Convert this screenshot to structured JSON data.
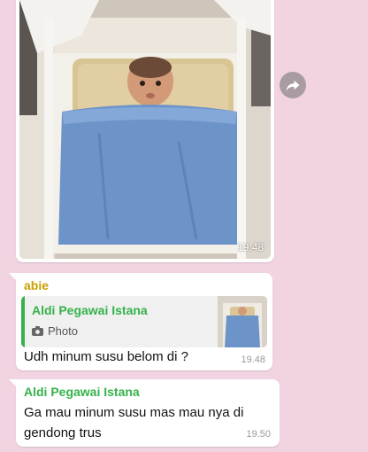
{
  "photo_message": {
    "time": "19.48"
  },
  "reply_message": {
    "sender": "abie",
    "quote": {
      "name": "Aldi  Pegawai Istana",
      "type": "Photo"
    },
    "text": "Udh minum susu belom di ?",
    "time": "19.48"
  },
  "text_message": {
    "sender": "Aldi  Pegawai Istana",
    "text": "Ga mau minum susu mas mau nya di gendong trus",
    "time": "19.50"
  },
  "colors": {
    "chat_background": "#f1d3e2",
    "reply_sender": "#c9a100",
    "quote_accent": "#35b24a"
  }
}
